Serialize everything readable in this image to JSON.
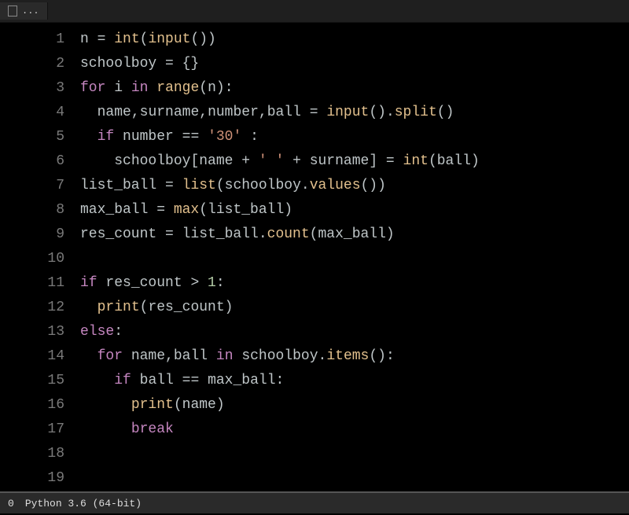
{
  "tab": {
    "filename": "..."
  },
  "status": {
    "errors": "0",
    "interpreter": "Python 3.6 (64-bit)"
  },
  "code": {
    "lines": [
      {
        "num": "1",
        "indent": 0,
        "tokens": [
          {
            "t": "n",
            "c": "ident"
          },
          {
            "t": " = ",
            "c": "op"
          },
          {
            "t": "int",
            "c": "func"
          },
          {
            "t": "(",
            "c": "punc"
          },
          {
            "t": "input",
            "c": "func"
          },
          {
            "t": "())",
            "c": "punc"
          }
        ]
      },
      {
        "num": "2",
        "indent": 0,
        "tokens": [
          {
            "t": "schoolboy",
            "c": "ident"
          },
          {
            "t": " = ",
            "c": "op"
          },
          {
            "t": "{}",
            "c": "punc"
          }
        ]
      },
      {
        "num": "3",
        "indent": 0,
        "tokens": [
          {
            "t": "for",
            "c": "kw"
          },
          {
            "t": " ",
            "c": "op"
          },
          {
            "t": "i",
            "c": "ident"
          },
          {
            "t": " ",
            "c": "op"
          },
          {
            "t": "in",
            "c": "kw"
          },
          {
            "t": " ",
            "c": "op"
          },
          {
            "t": "range",
            "c": "func"
          },
          {
            "t": "(",
            "c": "punc"
          },
          {
            "t": "n",
            "c": "ident"
          },
          {
            "t": "):",
            "c": "punc"
          }
        ]
      },
      {
        "num": "4",
        "indent": 1,
        "tokens": [
          {
            "t": "name",
            "c": "ident"
          },
          {
            "t": ",",
            "c": "punc"
          },
          {
            "t": "surname",
            "c": "ident"
          },
          {
            "t": ",",
            "c": "punc"
          },
          {
            "t": "number",
            "c": "ident"
          },
          {
            "t": ",",
            "c": "punc"
          },
          {
            "t": "ball",
            "c": "ident"
          },
          {
            "t": " = ",
            "c": "op"
          },
          {
            "t": "input",
            "c": "func"
          },
          {
            "t": "().",
            "c": "punc"
          },
          {
            "t": "split",
            "c": "func"
          },
          {
            "t": "()",
            "c": "punc"
          }
        ]
      },
      {
        "num": "5",
        "indent": 1,
        "tokens": [
          {
            "t": "if",
            "c": "kw"
          },
          {
            "t": " ",
            "c": "op"
          },
          {
            "t": "number",
            "c": "ident"
          },
          {
            "t": " == ",
            "c": "op"
          },
          {
            "t": "'30'",
            "c": "str"
          },
          {
            "t": " :",
            "c": "punc"
          }
        ]
      },
      {
        "num": "6",
        "indent": 2,
        "tokens": [
          {
            "t": "schoolboy",
            "c": "ident"
          },
          {
            "t": "[",
            "c": "punc"
          },
          {
            "t": "name",
            "c": "ident"
          },
          {
            "t": " + ",
            "c": "op"
          },
          {
            "t": "' '",
            "c": "str"
          },
          {
            "t": " + ",
            "c": "op"
          },
          {
            "t": "surname",
            "c": "ident"
          },
          {
            "t": "] = ",
            "c": "punc"
          },
          {
            "t": "int",
            "c": "func"
          },
          {
            "t": "(",
            "c": "punc"
          },
          {
            "t": "ball",
            "c": "ident"
          },
          {
            "t": ")",
            "c": "punc"
          }
        ]
      },
      {
        "num": "7",
        "indent": 0,
        "tokens": [
          {
            "t": "list_ball",
            "c": "ident"
          },
          {
            "t": " = ",
            "c": "op"
          },
          {
            "t": "list",
            "c": "func"
          },
          {
            "t": "(",
            "c": "punc"
          },
          {
            "t": "schoolboy",
            "c": "ident"
          },
          {
            "t": ".",
            "c": "punc"
          },
          {
            "t": "values",
            "c": "func"
          },
          {
            "t": "())",
            "c": "punc"
          }
        ]
      },
      {
        "num": "8",
        "indent": 0,
        "tokens": [
          {
            "t": "max_ball",
            "c": "ident"
          },
          {
            "t": " = ",
            "c": "op"
          },
          {
            "t": "max",
            "c": "func"
          },
          {
            "t": "(",
            "c": "punc"
          },
          {
            "t": "list_ball",
            "c": "ident"
          },
          {
            "t": ")",
            "c": "punc"
          }
        ]
      },
      {
        "num": "9",
        "indent": 0,
        "tokens": [
          {
            "t": "res_count",
            "c": "ident"
          },
          {
            "t": " = ",
            "c": "op"
          },
          {
            "t": "list_ball",
            "c": "ident"
          },
          {
            "t": ".",
            "c": "punc"
          },
          {
            "t": "count",
            "c": "func"
          },
          {
            "t": "(",
            "c": "punc"
          },
          {
            "t": "max_ball",
            "c": "ident"
          },
          {
            "t": ")",
            "c": "punc"
          }
        ]
      },
      {
        "num": "10",
        "indent": 0,
        "tokens": []
      },
      {
        "num": "11",
        "indent": 0,
        "tokens": [
          {
            "t": "if",
            "c": "kw"
          },
          {
            "t": " ",
            "c": "op"
          },
          {
            "t": "res_count",
            "c": "ident"
          },
          {
            "t": " > ",
            "c": "op"
          },
          {
            "t": "1",
            "c": "num"
          },
          {
            "t": ":",
            "c": "punc"
          }
        ]
      },
      {
        "num": "12",
        "indent": 1,
        "tokens": [
          {
            "t": "print",
            "c": "func"
          },
          {
            "t": "(",
            "c": "punc"
          },
          {
            "t": "res_count",
            "c": "ident"
          },
          {
            "t": ")",
            "c": "punc"
          }
        ]
      },
      {
        "num": "13",
        "indent": 0,
        "tokens": [
          {
            "t": "else",
            "c": "kw"
          },
          {
            "t": ":",
            "c": "punc"
          }
        ]
      },
      {
        "num": "14",
        "indent": 1,
        "tokens": [
          {
            "t": "for",
            "c": "kw"
          },
          {
            "t": " ",
            "c": "op"
          },
          {
            "t": "name",
            "c": "ident"
          },
          {
            "t": ",",
            "c": "punc"
          },
          {
            "t": "ball",
            "c": "ident"
          },
          {
            "t": " ",
            "c": "op"
          },
          {
            "t": "in",
            "c": "kw"
          },
          {
            "t": " ",
            "c": "op"
          },
          {
            "t": "schoolboy",
            "c": "ident"
          },
          {
            "t": ".",
            "c": "punc"
          },
          {
            "t": "items",
            "c": "func"
          },
          {
            "t": "():",
            "c": "punc"
          }
        ]
      },
      {
        "num": "15",
        "indent": 2,
        "tokens": [
          {
            "t": "if",
            "c": "kw"
          },
          {
            "t": " ",
            "c": "op"
          },
          {
            "t": "ball",
            "c": "ident"
          },
          {
            "t": " == ",
            "c": "op"
          },
          {
            "t": "max_ball",
            "c": "ident"
          },
          {
            "t": ":",
            "c": "punc"
          }
        ]
      },
      {
        "num": "16",
        "indent": 3,
        "tokens": [
          {
            "t": "print",
            "c": "func"
          },
          {
            "t": "(",
            "c": "punc"
          },
          {
            "t": "name",
            "c": "ident"
          },
          {
            "t": ")",
            "c": "punc"
          }
        ]
      },
      {
        "num": "17",
        "indent": 3,
        "tokens": [
          {
            "t": "break",
            "c": "kw"
          }
        ]
      },
      {
        "num": "18",
        "indent": 0,
        "tokens": []
      },
      {
        "num": "19",
        "indent": 0,
        "tokens": []
      }
    ]
  }
}
